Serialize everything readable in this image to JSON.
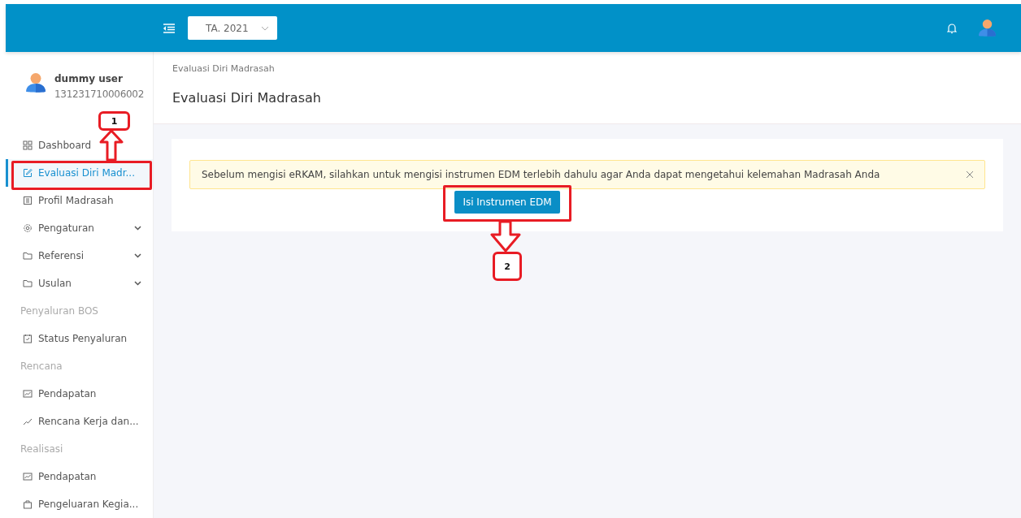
{
  "header": {
    "year_select": "TA. 2021"
  },
  "user": {
    "name": "dummy user",
    "id": "131231710006002"
  },
  "sidebar": {
    "items": [
      {
        "kind": "item",
        "label": "Dashboard",
        "selected": false
      },
      {
        "kind": "item",
        "label": "Evaluasi Diri Madr...",
        "selected": true
      },
      {
        "kind": "item",
        "label": "Profil Madrasah",
        "selected": false
      },
      {
        "kind": "group",
        "label": "Pengaturan",
        "selected": false
      },
      {
        "kind": "group",
        "label": "Referensi",
        "selected": false
      },
      {
        "kind": "group",
        "label": "Usulan",
        "selected": false
      },
      {
        "kind": "section",
        "label": "Penyaluran BOS"
      },
      {
        "kind": "item",
        "label": "Status Penyaluran",
        "selected": false
      },
      {
        "kind": "section",
        "label": "Rencana"
      },
      {
        "kind": "item",
        "label": "Pendapatan",
        "selected": false
      },
      {
        "kind": "item",
        "label": "Rencana Kerja dan...",
        "selected": false
      },
      {
        "kind": "section",
        "label": "Realisasi"
      },
      {
        "kind": "item",
        "label": "Pendapatan",
        "selected": false
      },
      {
        "kind": "item",
        "label": "Pengeluaran Kegia...",
        "selected": false
      }
    ]
  },
  "breadcrumb": "Evaluasi Diri Madrasah",
  "page_title": "Evaluasi Diri Madrasah",
  "alert": "Sebelum mengisi eRKAM, silahkan untuk mengisi instrumen EDM terlebih dahulu agar Anda dapat mengetahui kelemahan Madrasah Anda",
  "action_button": "Isi Instrumen EDM",
  "annotations": [
    {
      "label": "1"
    },
    {
      "label": "2"
    }
  ]
}
